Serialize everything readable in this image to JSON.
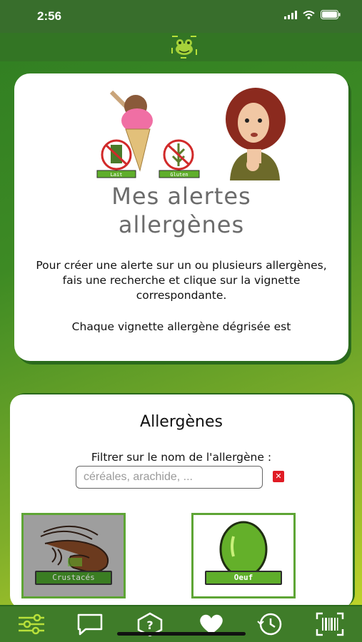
{
  "status_bar": {
    "time": "2:56"
  },
  "app": {
    "logo_icon": "frog-logo-icon"
  },
  "intro_card": {
    "title_line1": "Mes alertes",
    "title_line2": "allergènes",
    "illustration_badges": [
      "Lait",
      "Gluten"
    ],
    "text_1": "Pour créer une alerte sur un ou plusieurs allergènes, fais une recherche et clique sur la vignette correspondante.",
    "text_2": "Chaque vignette allergène dégrisée est"
  },
  "allergens_card": {
    "title": "Allergènes",
    "filter_label": "Filtrer sur le nom de l'allergène :",
    "search": {
      "value": "",
      "placeholder": "céréales, arachide, ..."
    },
    "clear_icon": "close-icon",
    "tiles": [
      {
        "label": "Crustacés",
        "icon": "shrimp-icon",
        "active": false
      },
      {
        "label": "Oeuf",
        "icon": "egg-icon",
        "active": true
      }
    ]
  },
  "tab_bar": {
    "items": [
      {
        "icon": "sliders-icon"
      },
      {
        "icon": "chat-icon"
      },
      {
        "icon": "help-hexagon-icon"
      },
      {
        "icon": "heart-icon",
        "selected": true
      },
      {
        "icon": "history-clock-icon"
      },
      {
        "icon": "barcode-scan-icon"
      }
    ]
  },
  "colors": {
    "primary_green": "#3f7c29",
    "accent_green": "#5fae2b",
    "alert_red": "#e01b24"
  }
}
